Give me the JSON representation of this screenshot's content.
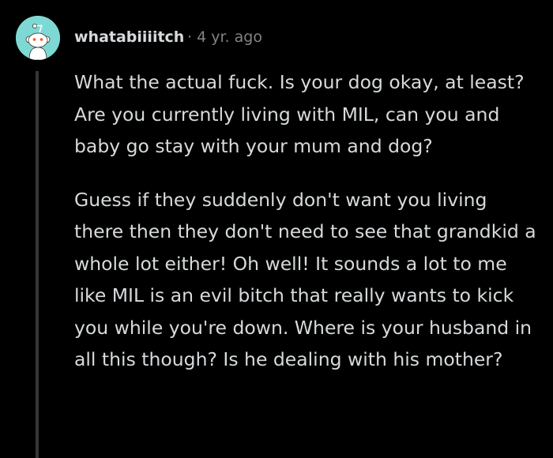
{
  "comment": {
    "avatar_icon": "reddit-snoo-avatar-icon",
    "avatar_color": "#7ed9d4",
    "username": "whatabiiiitch",
    "separator": "·",
    "timestamp": "4 yr. ago",
    "paragraphs": [
      "What the actual fuck. Is your dog okay, at least? Are you currently living with MIL, can you and baby go stay with your mum and dog?",
      "Guess if they suddenly don't want you living there then they don't need to see that grandkid a whole lot either! Oh well! It sounds a lot to me like MIL is an evil bitch that really wants to kick you while you're down. Where is your husband in all this though? Is he dealing with his mother?"
    ]
  },
  "colors": {
    "background": "#000000",
    "text": "#d7dadc",
    "meta": "#818384",
    "thread_line": "#343536"
  }
}
